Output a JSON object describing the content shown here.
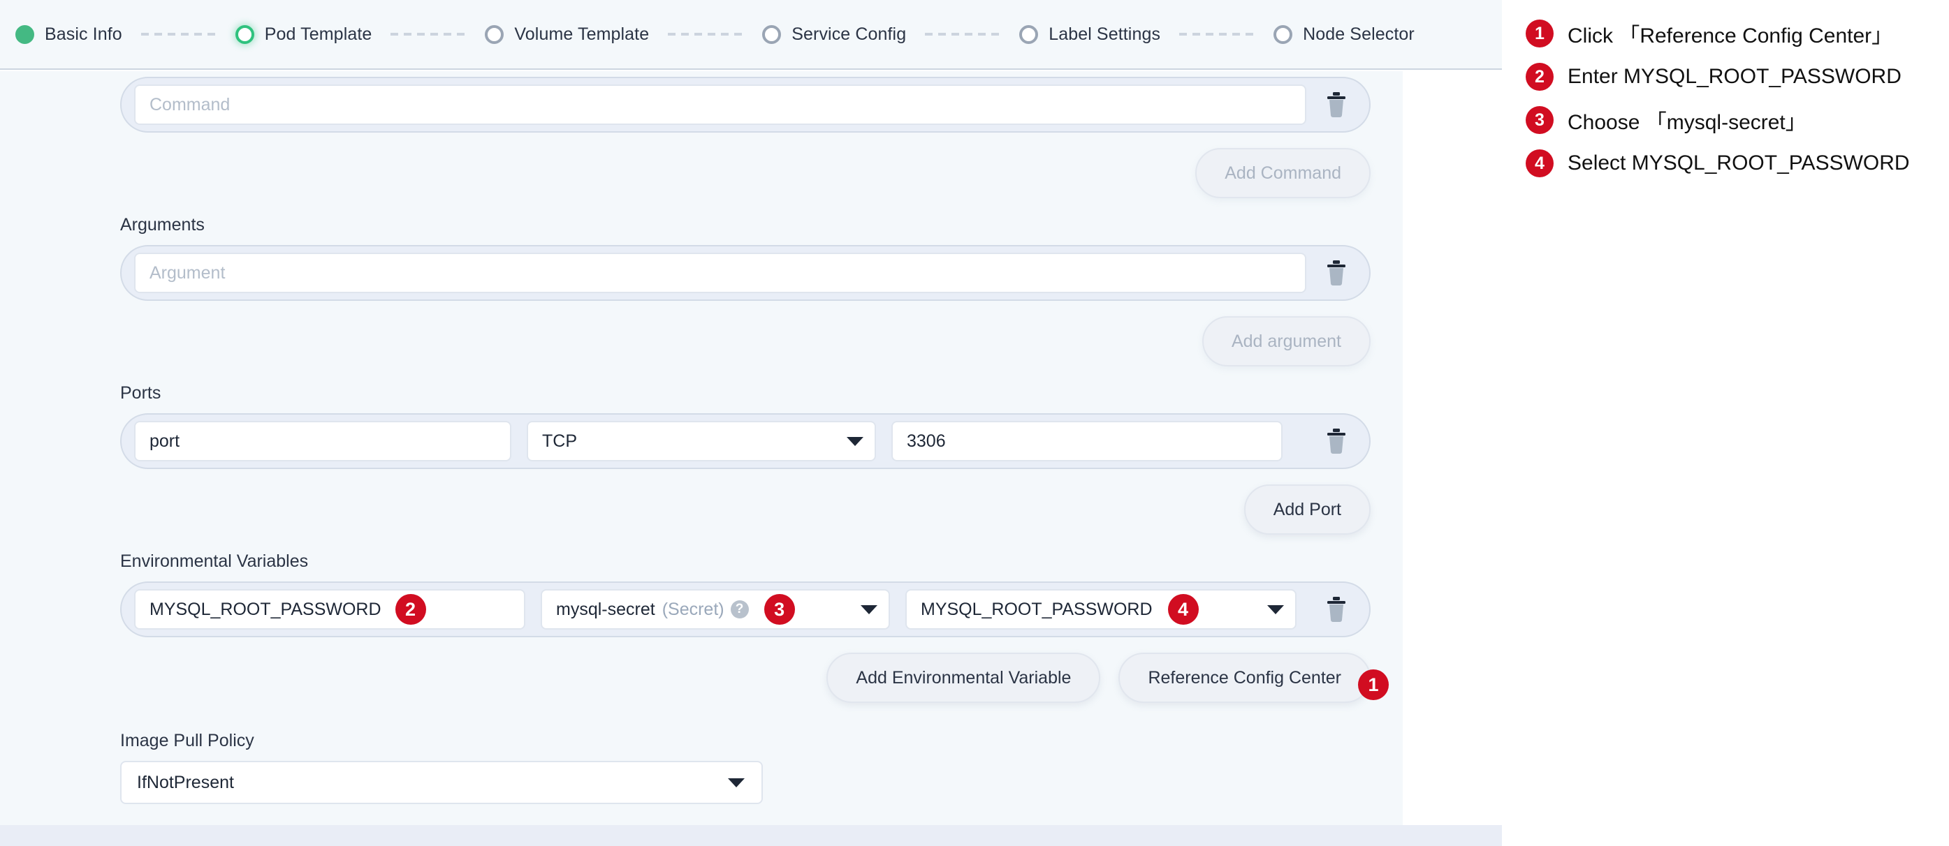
{
  "stepper": {
    "steps": [
      {
        "label": "Basic Info",
        "state": "done"
      },
      {
        "label": "Pod Template",
        "state": "active"
      },
      {
        "label": "Volume Template",
        "state": "pending"
      },
      {
        "label": "Service Config",
        "state": "pending"
      },
      {
        "label": "Label Settings",
        "state": "pending"
      },
      {
        "label": "Node Selector",
        "state": "pending"
      }
    ]
  },
  "form": {
    "command": {
      "placeholder": "Command",
      "add_label": "Add Command",
      "delete_icon": "trash-icon"
    },
    "arguments": {
      "label": "Arguments",
      "placeholder": "Argument",
      "add_label": "Add argument",
      "delete_icon": "trash-icon"
    },
    "ports": {
      "label": "Ports",
      "name_value": "port",
      "protocol_value": "TCP",
      "port_value": "3306",
      "add_label": "Add Port",
      "delete_icon": "trash-icon"
    },
    "env": {
      "label": "Environmental Variables",
      "name_value": "MYSQL_ROOT_PASSWORD",
      "source_value": "mysql-secret",
      "source_kind": "(Secret)",
      "help_icon": "question-mark-icon",
      "key_value": "MYSQL_ROOT_PASSWORD",
      "add_label": "Add Environmental Variable",
      "reference_label": "Reference Config Center",
      "delete_icon": "trash-icon",
      "marker_name": "2",
      "marker_source": "3",
      "marker_key": "4",
      "marker_reference": "1"
    },
    "image_pull_policy": {
      "label": "Image Pull Policy",
      "value": "IfNotPresent"
    }
  },
  "annotations": {
    "steps": [
      {
        "num": "1",
        "text": "Click 「Reference Config Center」"
      },
      {
        "num": "2",
        "text": "Enter MYSQL_ROOT_PASSWORD"
      },
      {
        "num": "3",
        "text": "Choose 「mysql-secret」"
      },
      {
        "num": "4",
        "text": "Select MYSQL_ROOT_PASSWORD"
      }
    ]
  },
  "colors": {
    "accent_green": "#2fc27e",
    "marker_red": "#d10d21",
    "panel_bg": "#f4f8fb"
  }
}
